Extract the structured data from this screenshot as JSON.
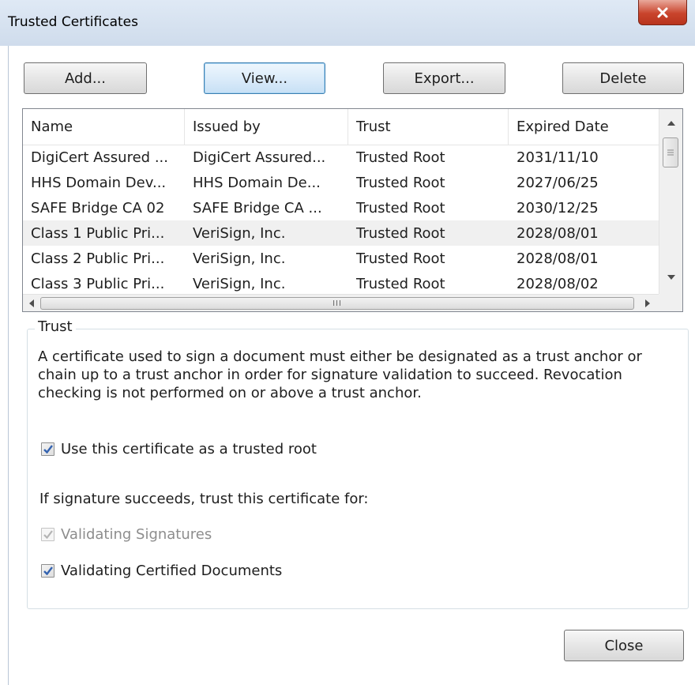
{
  "window": {
    "title": "Trusted Certificates"
  },
  "toolbar": {
    "add_label": "Add...",
    "view_label": "View...",
    "export_label": "Export...",
    "delete_label": "Delete"
  },
  "table": {
    "columns": [
      "Name",
      "Issued by",
      "Trust",
      "Expired Date"
    ],
    "rows": [
      [
        "DigiCert Assured ...",
        "DigiCert Assured...",
        "Trusted Root",
        "2031/11/10"
      ],
      [
        "HHS Domain Dev...",
        "HHS Domain De...",
        "Trusted Root",
        "2027/06/25"
      ],
      [
        "SAFE Bridge CA 02",
        "SAFE Bridge CA ...",
        "Trusted Root",
        "2030/12/25"
      ],
      [
        "Class 1 Public Pri...",
        "VeriSign, Inc.",
        "Trusted Root",
        "2028/08/01"
      ],
      [
        "Class 2 Public Pri...",
        "VeriSign, Inc.",
        "Trusted Root",
        "2028/08/01"
      ],
      [
        "Class 3 Public Pri...",
        "VeriSign, Inc.",
        "Trusted Root",
        "2028/08/02"
      ]
    ],
    "selected_row": 3,
    "scroll_grip": "III"
  },
  "trust": {
    "legend": "Trust",
    "description": "A certificate used to sign a document must either be designated as a trust anchor or chain up to a trust anchor in order for signature validation to succeed. Revocation checking is not performed on or above a trust anchor.",
    "use_as_root_label": "Use this certificate as a trusted root",
    "use_as_root_checked": true,
    "if_succeeds_label": "If signature succeeds, trust this certificate for:",
    "validating_signatures_label": "Validating Signatures",
    "validating_signatures_checked": true,
    "validating_signatures_disabled": true,
    "validating_certified_label": "Validating Certified Documents",
    "validating_certified_checked": true
  },
  "footer": {
    "close_label": "Close"
  },
  "colors": {
    "accent": "#3c7fb1",
    "close_red": "#c9442c",
    "selected_row": "#f0f0f0"
  },
  "icons": [
    "close-icon",
    "scroll-up-icon",
    "scroll-down-icon",
    "scroll-left-icon",
    "scroll-right-icon",
    "checkmark-icon"
  ]
}
